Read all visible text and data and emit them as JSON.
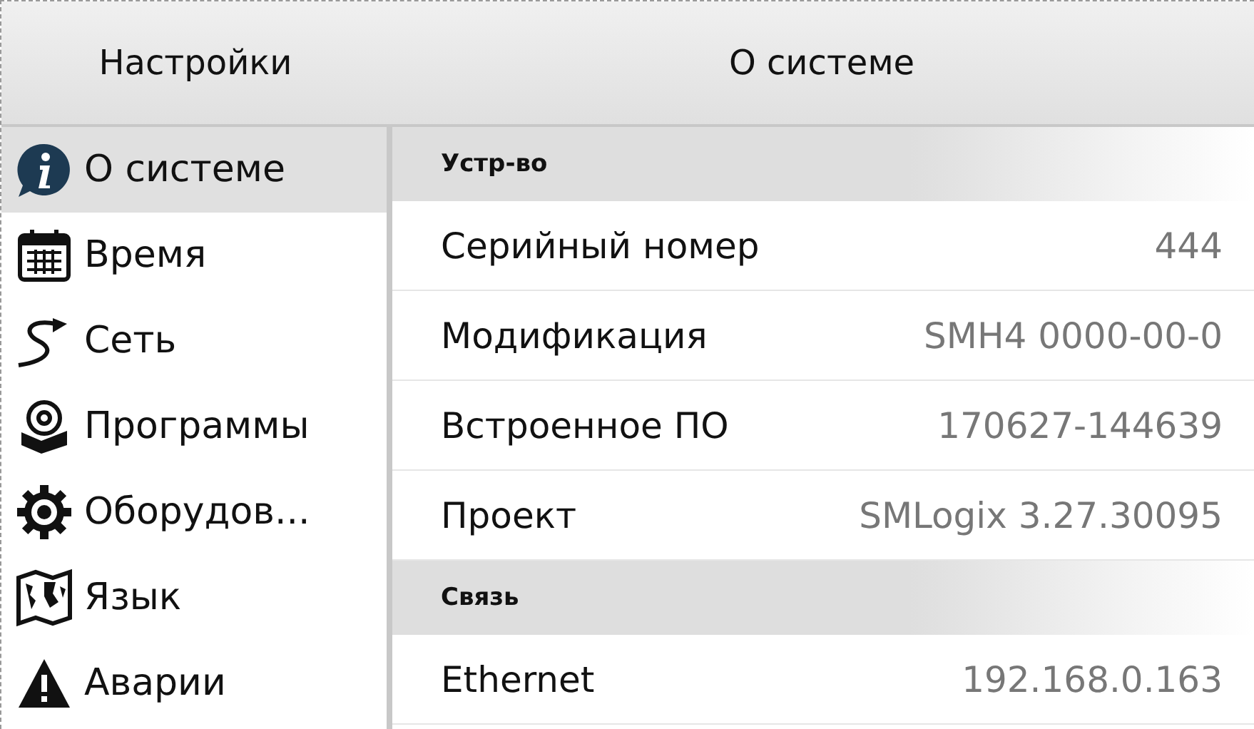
{
  "sidebar": {
    "title": "Настройки",
    "items": [
      {
        "label": "О системе",
        "selected": true
      },
      {
        "label": "Время",
        "selected": false
      },
      {
        "label": "Сеть",
        "selected": false
      },
      {
        "label": "Программы",
        "selected": false
      },
      {
        "label": "Оборудов...",
        "selected": false
      },
      {
        "label": "Язык",
        "selected": false
      },
      {
        "label": "Аварии",
        "selected": false
      }
    ]
  },
  "panel": {
    "title": "О системе",
    "sections": [
      {
        "title": "Устр-во",
        "rows": [
          {
            "label": "Серийный номер",
            "value": "444"
          },
          {
            "label": "Модификация",
            "value": "SMH4 0000-00-0"
          },
          {
            "label": "Встроенное ПО",
            "value": "170627-144639"
          },
          {
            "label": "Проект",
            "value": "SMLogix 3.27.30095"
          }
        ]
      },
      {
        "title": "Связь",
        "rows": [
          {
            "label": "Ethernet",
            "value": "192.168.0.163"
          }
        ]
      }
    ]
  }
}
